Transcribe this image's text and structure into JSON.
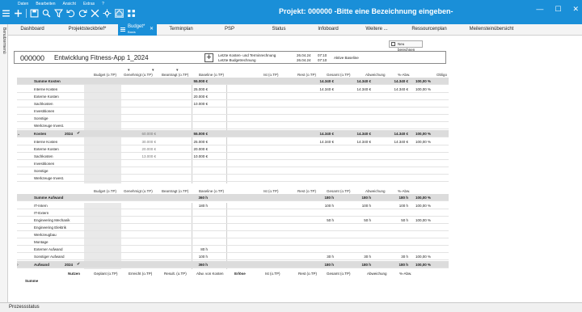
{
  "menu": [
    "Daten",
    "Bearbeiten",
    "Ansicht",
    "Extras",
    "?"
  ],
  "app_title": "Projekt: 000000 -Bitte eine Bezeichnung eingeben-",
  "tabs": [
    {
      "label": "Dashboard"
    },
    {
      "label": "Projektsteckbrief*"
    },
    {
      "label": "Budget*",
      "sub": "Basis"
    },
    {
      "label": "Terminplan"
    },
    {
      "label": "PSP"
    },
    {
      "label": "Status"
    },
    {
      "label": "Infoboard"
    },
    {
      "label": "Weitere ..."
    },
    {
      "label": "Ressourcenplan"
    },
    {
      "label": "Meilensteinübersicht"
    }
  ],
  "sidebar_label": "Benutzermenü",
  "new_calc_button": "Neu berechnen",
  "project": {
    "number": "000000",
    "name": "Entwicklung Fitness-App 1_2024",
    "info1": "Letzte Kosten- und Terminrechnung",
    "info2": "Letzte Budgetrechnung",
    "date1": "26.04.24",
    "date2": "26.04.24",
    "time1": "07:10",
    "time2": "07:10",
    "baseline": "Aktive Baseline"
  },
  "cost_headers": [
    "Budget (o.TP)",
    "Genehmigt (o.TP)",
    "Beantragt (o.TP)",
    "Baseline (o.TP)",
    "Ist (o.TP)",
    "Rest (o.TP)",
    "Gesamt (o.TP)",
    "Abweichung",
    "%-Abw.",
    "Obligo"
  ],
  "cost_sum": {
    "label": "Summe Kosten",
    "beantragt": "55.000 €",
    "rest": "14.340 €",
    "gesamt": "14.340 €",
    "abw": "14.340 €",
    "pct": "100,00 %"
  },
  "cost_rows": [
    {
      "label": "Interne Kosten",
      "beantragt": "25.000 €",
      "rest": "14.340 €",
      "gesamt": "14.340 €",
      "abw": "14.340 €",
      "pct": "100,00 %"
    },
    {
      "label": "Externe Kosten",
      "beantragt": "20.000 €"
    },
    {
      "label": "Sachkosten",
      "beantragt": "10.000 €"
    },
    {
      "label": "Investitionen"
    },
    {
      "label": "Sonstige"
    },
    {
      "label": "Werkzeuge Invest."
    }
  ],
  "cost_year": {
    "label": "Kosten",
    "year": "2024",
    "genehmigt": "60.000 €",
    "beantragt": "55.000 €",
    "rest": "14.340 €",
    "gesamt": "14.340 €",
    "abw": "14.340 €",
    "pct": "100,00 %"
  },
  "cost_year_rows": [
    {
      "label": "Interne Kosten",
      "genehmigt": "30.000 €",
      "beantragt": "25.000 €",
      "rest": "14.340 €",
      "gesamt": "14.340 €",
      "abw": "14.340 €",
      "pct": "100,00 %"
    },
    {
      "label": "Externe Kosten",
      "genehmigt": "20.000 €",
      "beantragt": "20.000 €"
    },
    {
      "label": "Sachkosten",
      "genehmigt": "13.000 €",
      "beantragt": "10.000 €"
    },
    {
      "label": "Investitionen"
    },
    {
      "label": "Sonstige"
    },
    {
      "label": "Werkzeuge Invest."
    }
  ],
  "effort_headers": [
    "Budget (o.TP)",
    "Genehmigt (o.TP)",
    "Beantragt (o.TP)",
    "Baseline (o.TP)",
    "Ist (o.TP)",
    "Rest (o.TP)",
    "Gesamt (o.TP)",
    "Abweichung",
    "%-Abw."
  ],
  "effort_sum": {
    "label": "Summe Aufwand",
    "beantragt": "360 h",
    "rest": "180 h",
    "gesamt": "180 h",
    "abw": "180 h",
    "pct": "100,00 %"
  },
  "effort_rows": [
    {
      "label": "IT-Intern",
      "beantragt": "180 h",
      "rest": "100 h",
      "gesamt": "100 h",
      "abw": "100 h",
      "pct": "100,00 %"
    },
    {
      "label": "IT-Extern"
    },
    {
      "label": "Engineering Mechanik",
      "rest": "50 h",
      "gesamt": "50 h",
      "abw": "50 h",
      "pct": "100,00 %"
    },
    {
      "label": "Engineering Elektrik"
    },
    {
      "label": "Werkzeugbau"
    },
    {
      "label": "Montage"
    },
    {
      "label": "Externer Aufwand",
      "beantragt": "80 h"
    },
    {
      "label": "Sonstiger Aufwand",
      "beantragt": "100 h",
      "rest": "30 h",
      "gesamt": "30 h",
      "abw": "30 h",
      "pct": "100,00 %"
    }
  ],
  "effort_year": {
    "label": "Aufwand",
    "year": "2024",
    "beantragt": "360 h",
    "rest": "180 h",
    "gesamt": "180 h",
    "abw": "180 h",
    "pct": "100,00 %"
  },
  "benefit_headers": {
    "nutzen": "Nutzen",
    "geplant": "Geplant (o.TP)",
    "erreicht": "Erreicht (o.TP)",
    "result": "Result. (o.TP)",
    "abwkosten": "Abw. von Kosten",
    "erloese": "Erlöse",
    "ist": "Ist (o.TP)",
    "rest": "Rest (o.TP)",
    "gesamt": "Gesamt (o.TP)",
    "abw": "Abweichung",
    "pct": "%-Abw."
  },
  "benefit_sum": "Summe",
  "status_bar": "Prozessstatus",
  "colors": {
    "accent": "#1a8fd8",
    "sum_row": "#dcdcdc"
  }
}
